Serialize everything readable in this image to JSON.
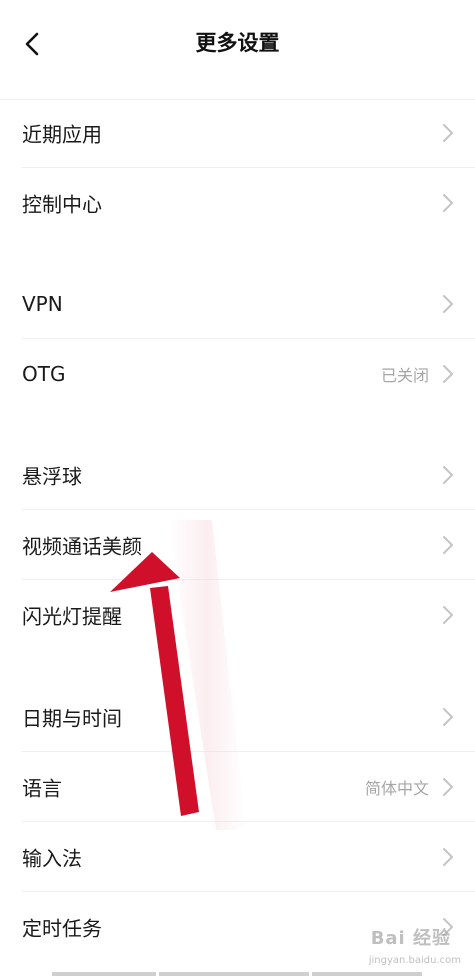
{
  "header": {
    "title": "更多设置",
    "back_icon": "chevron-left-icon"
  },
  "rows": [
    {
      "label": "近期应用",
      "value": ""
    },
    {
      "label": "控制中心",
      "value": ""
    },
    {
      "label": "VPN",
      "value": ""
    },
    {
      "label": "OTG",
      "value": "已关闭"
    },
    {
      "label": "悬浮球",
      "value": ""
    },
    {
      "label": "视频通话美颜",
      "value": ""
    },
    {
      "label": "闪光灯提醒",
      "value": ""
    },
    {
      "label": "日期与时间",
      "value": ""
    },
    {
      "label": "语言",
      "value": "简体中文"
    },
    {
      "label": "输入法",
      "value": ""
    },
    {
      "label": "定时任务",
      "value": ""
    }
  ],
  "annotation": {
    "arrow_color": "#d0102a",
    "target_row": "视频通话美颜"
  },
  "watermark": {
    "text": "Bai 经验",
    "sub": "jingyan.baidu.com"
  }
}
